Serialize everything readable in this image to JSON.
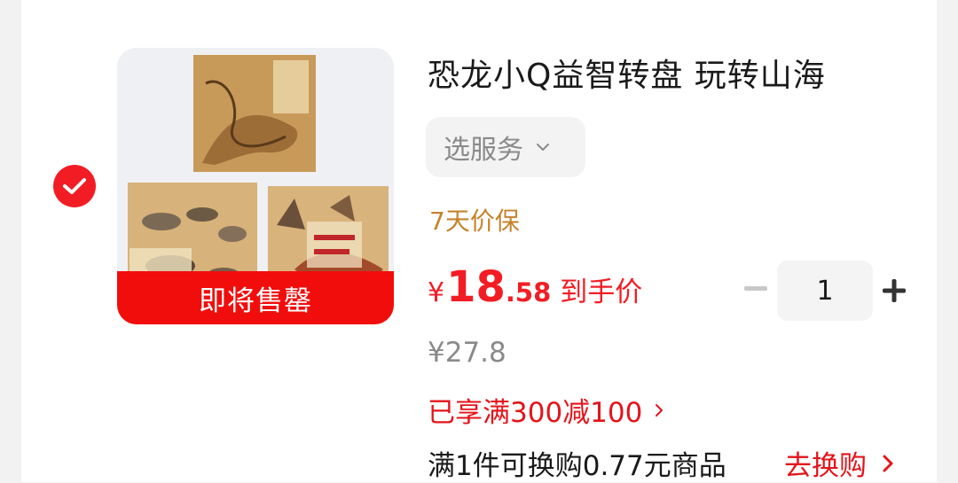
{
  "product": {
    "title": "恐龙小Q益智转盘 玩转山海",
    "selected": true,
    "image": {
      "name": "product-thumbnail",
      "badge": "即将售罄"
    },
    "service_button": "选服务",
    "guarantee": "7天价保",
    "price": {
      "currency": "¥",
      "integer": "18",
      "decimal": ".58",
      "label": "到手价"
    },
    "original_price": "¥27.8",
    "quantity": "1",
    "promotion": "已享满300减100",
    "trade_in": {
      "text": "满1件可换购0.77元商品",
      "link": "去换购"
    }
  },
  "icons": {
    "selected": "checkmark-circle-icon",
    "service_dropdown": "chevron-down-icon",
    "minus": "minus-icon",
    "plus": "plus-icon",
    "promo_arrow": "chevron-right-icon",
    "trade_in_arrow": "chevron-right-icon"
  },
  "colors": {
    "accent_red": "#f21d24",
    "guarantee_gold": "#c6832c",
    "muted_gray": "#8a8a8a"
  }
}
